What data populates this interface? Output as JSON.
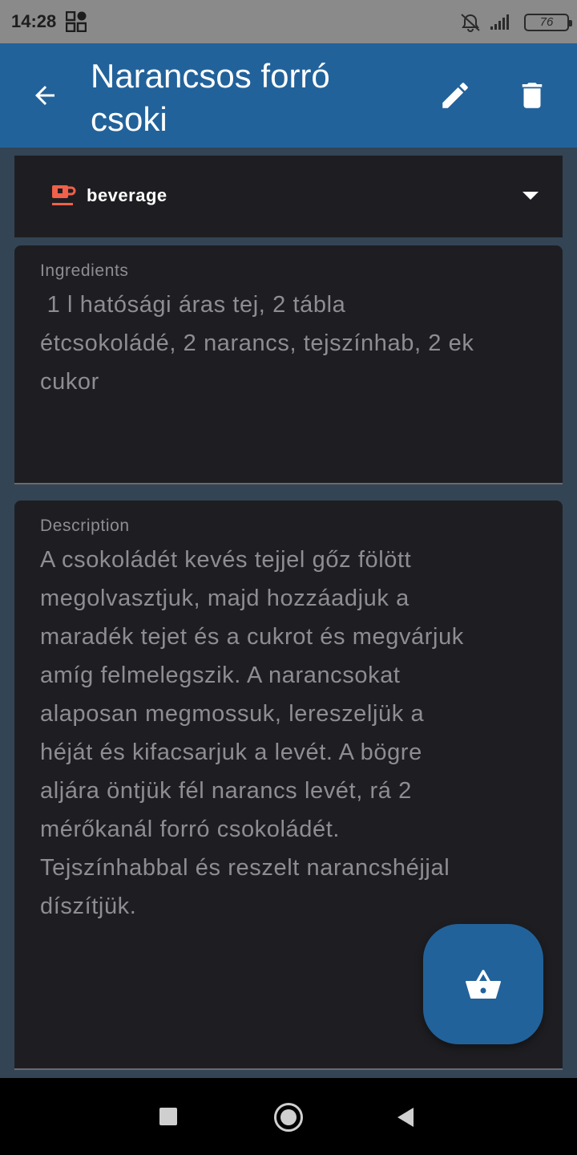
{
  "status_bar": {
    "time": "14:28",
    "battery": "76",
    "icons": [
      "grid-icon",
      "mute-icon",
      "signal-icon",
      "battery-icon"
    ]
  },
  "app_bar": {
    "title": "Narancsos forró csoki",
    "icons": [
      "back-arrow-icon",
      "edit-pencil-icon",
      "delete-trash-icon"
    ],
    "color": "#22629a"
  },
  "category": {
    "icon": "coffee-cup-icon",
    "icon_color": "#f0604a",
    "label": "beverage"
  },
  "ingredients": {
    "label": "Ingredients",
    "value": " 1 l hatósági áras tej, 2 tábla\nétcsokoládé, 2 narancs, tejszínhab, 2 ek\ncukor"
  },
  "description": {
    "label": "Description",
    "value": "A csokoládét kevés tejjel gőz fölött\nmegolvasztjuk, majd hozzáadjuk a\nmaradék tejet és a cukrot és megvárjuk\namíg felmelegszik. A narancsokat\nalaposan megmossuk, lereszeljük a\nhéját és kifacsarjuk a levét. A bögre\naljára öntjük fél narancs levét, rá 2\nmérőkanál forró csokoládét.\nTejszínhabbal és reszelt narancshéjjal\ndíszítjük."
  },
  "fab": {
    "icon": "shopping-basket-icon"
  },
  "nav_bar": {
    "icons": [
      "recents-square-icon",
      "home-circle-icon",
      "back-triangle-icon"
    ]
  }
}
